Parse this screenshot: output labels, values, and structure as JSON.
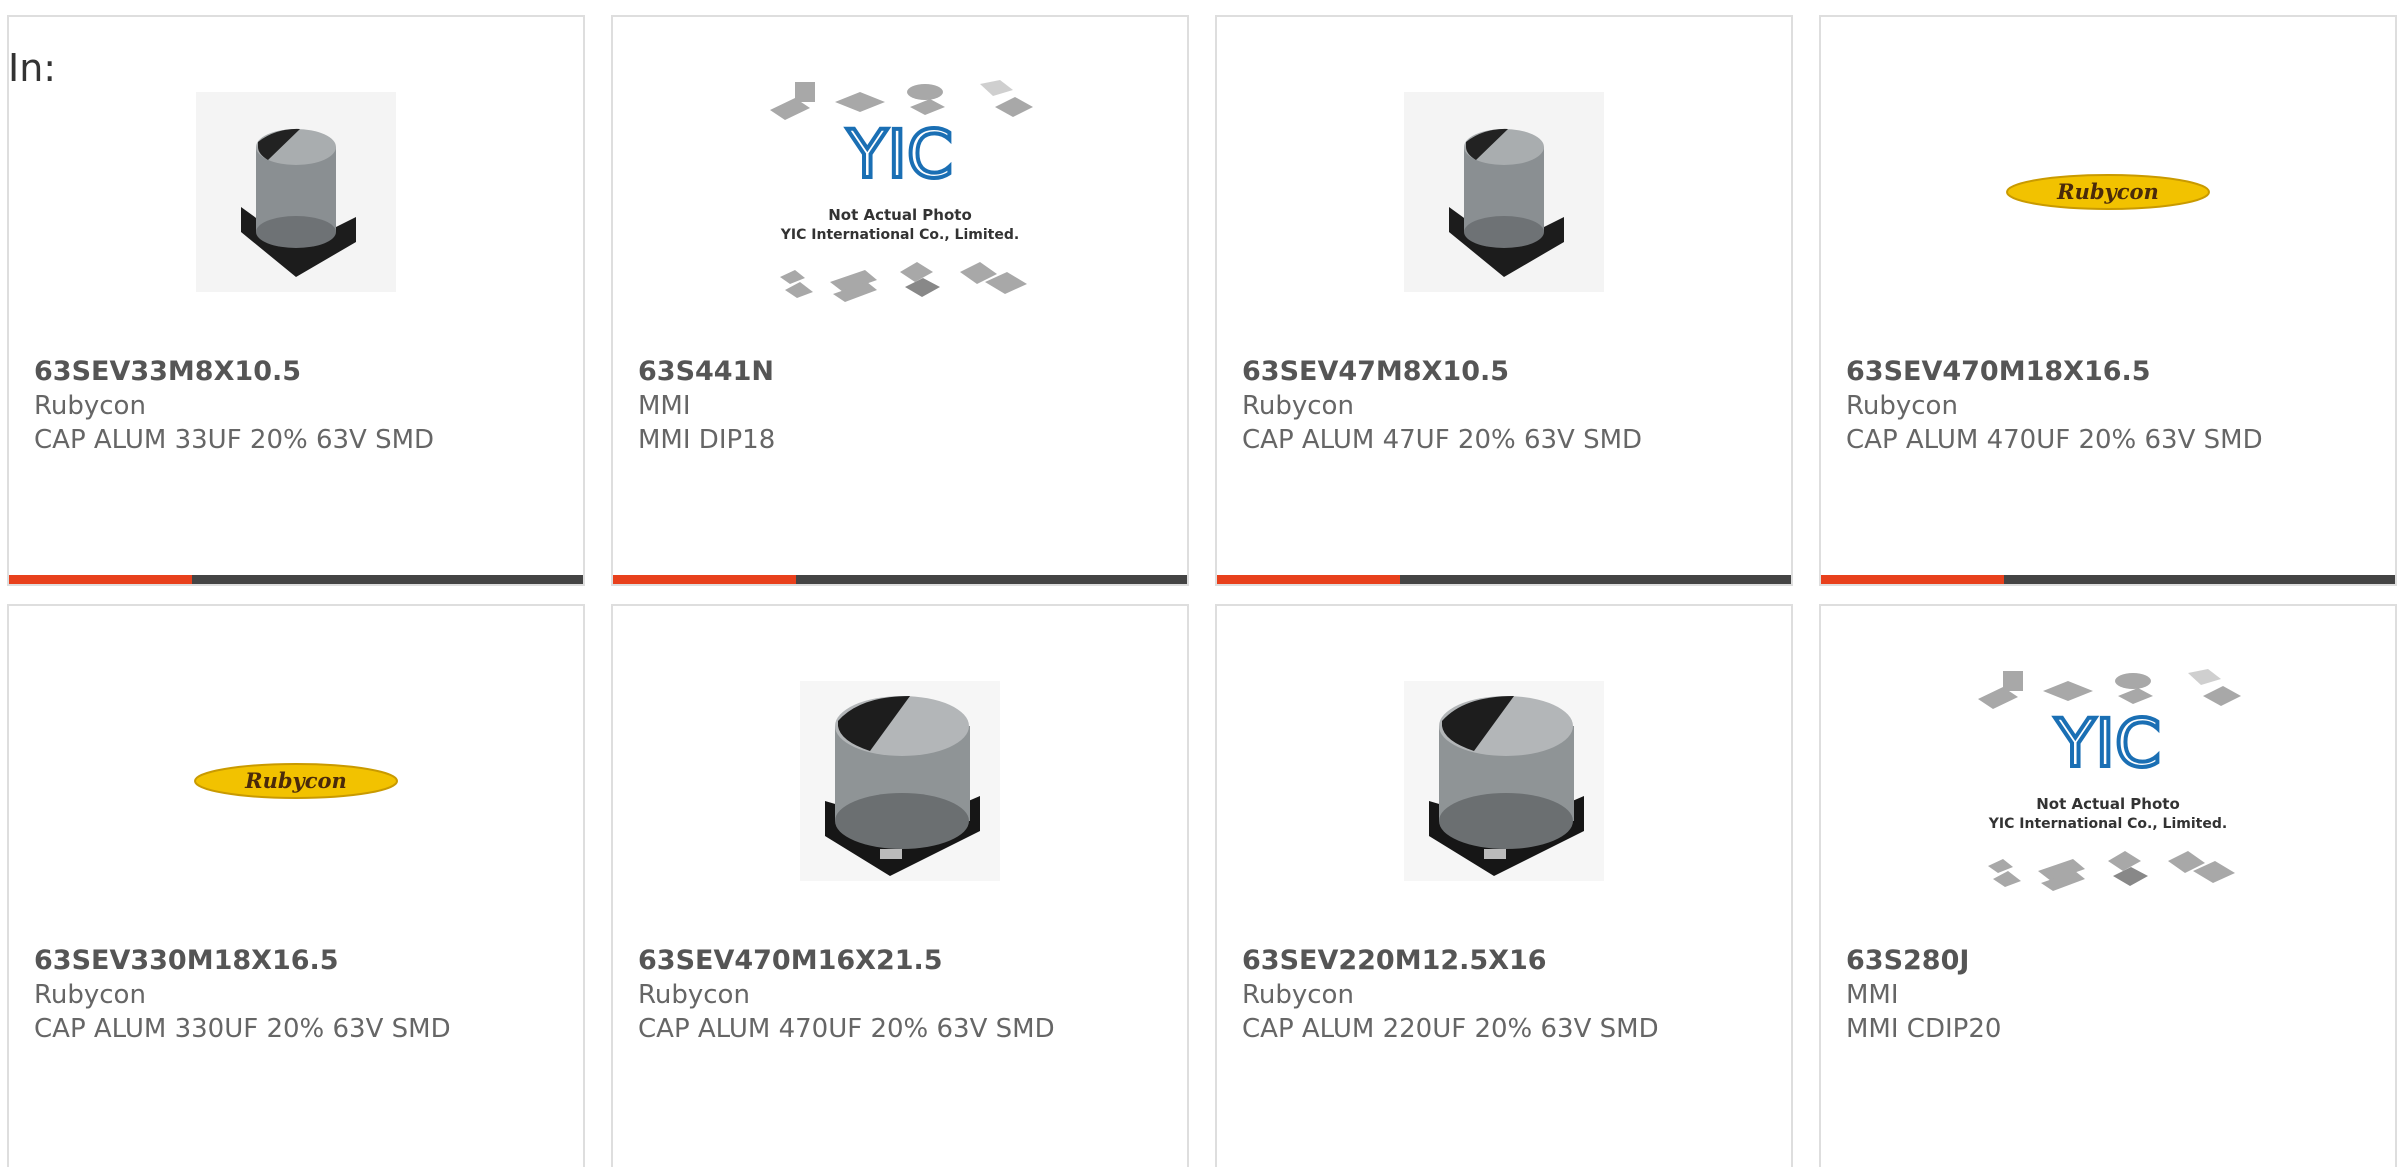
{
  "filter_label": "In:",
  "colors": {
    "accent_bar": "#e8401c",
    "bar_dark": "#444444",
    "card_border": "#dedede",
    "logo_yellow": "#f2c200"
  },
  "products": [
    {
      "part_number": "63SEV33M8X10.5",
      "manufacturer": "Rubycon",
      "description": "CAP ALUM 33UF 20% 63V SMD",
      "image": "capacitor-small"
    },
    {
      "part_number": "63S441N",
      "manufacturer": "MMI",
      "description": "MMI DIP18",
      "image": "yic-placeholder"
    },
    {
      "part_number": "63SEV47M8X10.5",
      "manufacturer": "Rubycon",
      "description": "CAP ALUM 47UF 20% 63V SMD",
      "image": "capacitor-small"
    },
    {
      "part_number": "63SEV470M18X16.5",
      "manufacturer": "Rubycon",
      "description": "CAP ALUM 470UF 20% 63V SMD",
      "image": "rubycon-logo"
    },
    {
      "part_number": "63SEV330M18X16.5",
      "manufacturer": "Rubycon",
      "description": "CAP ALUM 330UF 20% 63V SMD",
      "image": "rubycon-logo"
    },
    {
      "part_number": "63SEV470M16X21.5",
      "manufacturer": "Rubycon",
      "description": "CAP ALUM 470UF 20% 63V SMD",
      "image": "capacitor-large"
    },
    {
      "part_number": "63SEV220M12.5X16",
      "manufacturer": "Rubycon",
      "description": "CAP ALUM 220UF 20% 63V SMD",
      "image": "capacitor-large"
    },
    {
      "part_number": "63S280J",
      "manufacturer": "MMI",
      "description": "MMI CDIP20",
      "image": "yic-placeholder"
    }
  ],
  "placeholder_text": {
    "logo": "YIC",
    "line1": "Not Actual Photo",
    "line2": "YIC International Co., Limited."
  },
  "rubycon_logo_text": "Rubycon"
}
